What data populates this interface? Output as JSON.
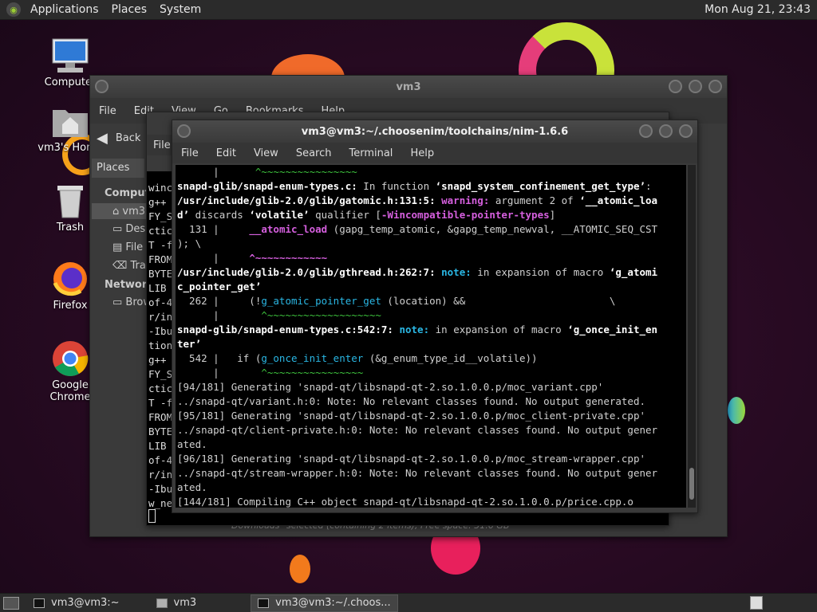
{
  "top_panel": {
    "menus": [
      "Applications",
      "Places",
      "System"
    ],
    "clock": "Mon Aug 21, 23:43"
  },
  "desktop_icons": [
    {
      "label": "Computer",
      "icon": "computer-icon"
    },
    {
      "label": "vm3's Home",
      "icon": "home-folder-icon"
    },
    {
      "label": "Trash",
      "icon": "trash-icon"
    },
    {
      "label": "Firefox",
      "icon": "firefox-icon"
    },
    {
      "label": "Google Chrome",
      "icon": "chrome-icon"
    }
  ],
  "file_manager": {
    "title": "vm3",
    "menus": [
      "File",
      "Edit",
      "View",
      "Go",
      "Bookmarks",
      "Help"
    ],
    "back_label": "Back",
    "places_label": "Places",
    "path_chip": "vm3",
    "sidebar": {
      "computer_heading": "Computer",
      "items": [
        "vm3",
        "Desktop",
        "File System",
        "Trash"
      ],
      "network_heading": "Network",
      "network_items": [
        "Browse Network"
      ]
    },
    "status": "\"Downloads\" selected (containing 2 items), Free space: 31.6 GB"
  },
  "back_terminal": {
    "menu_file": "File",
    "lines": [
      "winc",
      "g++ ",
      "FY_S",
      "ctic",
      "T -f",
      "FROM",
      "BYTE",
      "LIB ",
      "of-4",
      "r/in",
      "-Ibu",
      "tion",
      "g++ ",
      "FY_S",
      "ctic",
      "T -f",
      "FROM",
      "BYTE",
      "LIB ",
      "of-4",
      "r/in",
      "-Ibu",
      "w_ne"
    ]
  },
  "terminal": {
    "title": "vm3@vm3:~/.choosenim/toolchains/nim-1.6.6",
    "menus": [
      "File",
      "Edit",
      "View",
      "Search",
      "Terminal",
      "Help"
    ],
    "lines": [
      [
        {
          "t": "      |      ",
          "s": ""
        },
        {
          "t": "^~~~~~~~~~~~~~~~~",
          "s": "g"
        }
      ],
      [
        {
          "t": "snapd-glib/snapd-enum-types.c:",
          "s": "b"
        },
        {
          "t": " In function ",
          "s": ""
        },
        {
          "t": "‘snapd_system_confinement_get_type’",
          "s": "b"
        },
        {
          "t": ":",
          "s": ""
        }
      ],
      [
        {
          "t": "/usr/include/glib-2.0/glib/gatomic.h:131:5:",
          "s": "b"
        },
        {
          "t": " warning:",
          "s": "w"
        },
        {
          "t": " argument 2 of ",
          "s": ""
        },
        {
          "t": "‘__atomic_loa",
          "s": "b"
        }
      ],
      [
        {
          "t": "d’",
          "s": "b"
        },
        {
          "t": " discards ",
          "s": ""
        },
        {
          "t": "‘volatile’",
          "s": "b"
        },
        {
          "t": " qualifier [",
          "s": ""
        },
        {
          "t": "-Wincompatible-pointer-types",
          "s": "w"
        },
        {
          "t": "]",
          "s": ""
        }
      ],
      [
        {
          "t": "  131 |     ",
          "s": ""
        },
        {
          "t": "__atomic_load",
          "s": "w"
        },
        {
          "t": " (gapg_temp_atomic, &gapg_temp_newval, __ATOMIC_SEQ_CST",
          "s": ""
        }
      ],
      [
        {
          "t": "); \\",
          "s": ""
        }
      ],
      [
        {
          "t": "      |     ",
          "s": ""
        },
        {
          "t": "^~~~~~~~~~~~~",
          "s": "w"
        }
      ],
      [
        {
          "t": "/usr/include/glib-2.0/glib/gthread.h:262:7:",
          "s": "b"
        },
        {
          "t": " note:",
          "s": "n"
        },
        {
          "t": " in expansion of macro ",
          "s": ""
        },
        {
          "t": "‘g_atomi",
          "s": "b"
        }
      ],
      [
        {
          "t": "c_pointer_get’",
          "s": "b"
        }
      ],
      [
        {
          "t": "  262 |     (!",
          "s": ""
        },
        {
          "t": "g_atomic_pointer_get",
          "s": "c"
        },
        {
          "t": " (location) &&                        \\",
          "s": ""
        }
      ],
      [
        {
          "t": "      |       ",
          "s": ""
        },
        {
          "t": "^~~~~~~~~~~~~~~~~~~~",
          "s": "g"
        }
      ],
      [
        {
          "t": "snapd-glib/snapd-enum-types.c:542:7:",
          "s": "b"
        },
        {
          "t": " note:",
          "s": "n"
        },
        {
          "t": " in expansion of macro ",
          "s": ""
        },
        {
          "t": "‘g_once_init_en",
          "s": "b"
        }
      ],
      [
        {
          "t": "ter’",
          "s": "b"
        }
      ],
      [
        {
          "t": "  542 |   if (",
          "s": ""
        },
        {
          "t": "g_once_init_enter",
          "s": "c"
        },
        {
          "t": " (&g_enum_type_id__volatile))",
          "s": ""
        }
      ],
      [
        {
          "t": "      |       ",
          "s": ""
        },
        {
          "t": "^~~~~~~~~~~~~~~~~",
          "s": "g"
        }
      ],
      [
        {
          "t": "[94/181] Generating 'snapd-qt/libsnapd-qt-2.so.1.0.0.p/moc_variant.cpp'",
          "s": ""
        }
      ],
      [
        {
          "t": "../snapd-qt/variant.h:0: Note: No relevant classes found. No output generated.",
          "s": ""
        }
      ],
      [
        {
          "t": "[95/181] Generating 'snapd-qt/libsnapd-qt-2.so.1.0.0.p/moc_client-private.cpp'",
          "s": ""
        }
      ],
      [
        {
          "t": "../snapd-qt/client-private.h:0: Note: No relevant classes found. No output gener",
          "s": ""
        }
      ],
      [
        {
          "t": "ated.",
          "s": ""
        }
      ],
      [
        {
          "t": "[96/181] Generating 'snapd-qt/libsnapd-qt-2.so.1.0.0.p/moc_stream-wrapper.cpp'",
          "s": ""
        }
      ],
      [
        {
          "t": "../snapd-qt/stream-wrapper.h:0: Note: No relevant classes found. No output gener",
          "s": ""
        }
      ],
      [
        {
          "t": "ated.",
          "s": ""
        }
      ],
      [
        {
          "t": "[144/181] Compiling C++ object snapd-qt/libsnapd-qt-2.so.1.0.0.p/price.cpp.o",
          "s": ""
        }
      ]
    ]
  },
  "taskbar": {
    "tasks": [
      {
        "label": "vm3@vm3:~",
        "icon": "terminal-icon",
        "active": false
      },
      {
        "label": "vm3",
        "icon": "folder-icon",
        "active": false
      },
      {
        "label": "vm3@vm3:~/.choos...",
        "icon": "terminal-icon",
        "active": true
      }
    ]
  },
  "colors": {
    "panel": "#2b2b2b",
    "terminal_bg": "#000000",
    "warning": "#d55fde",
    "note": "#2ab7e4",
    "caret": "#3ec53e"
  }
}
